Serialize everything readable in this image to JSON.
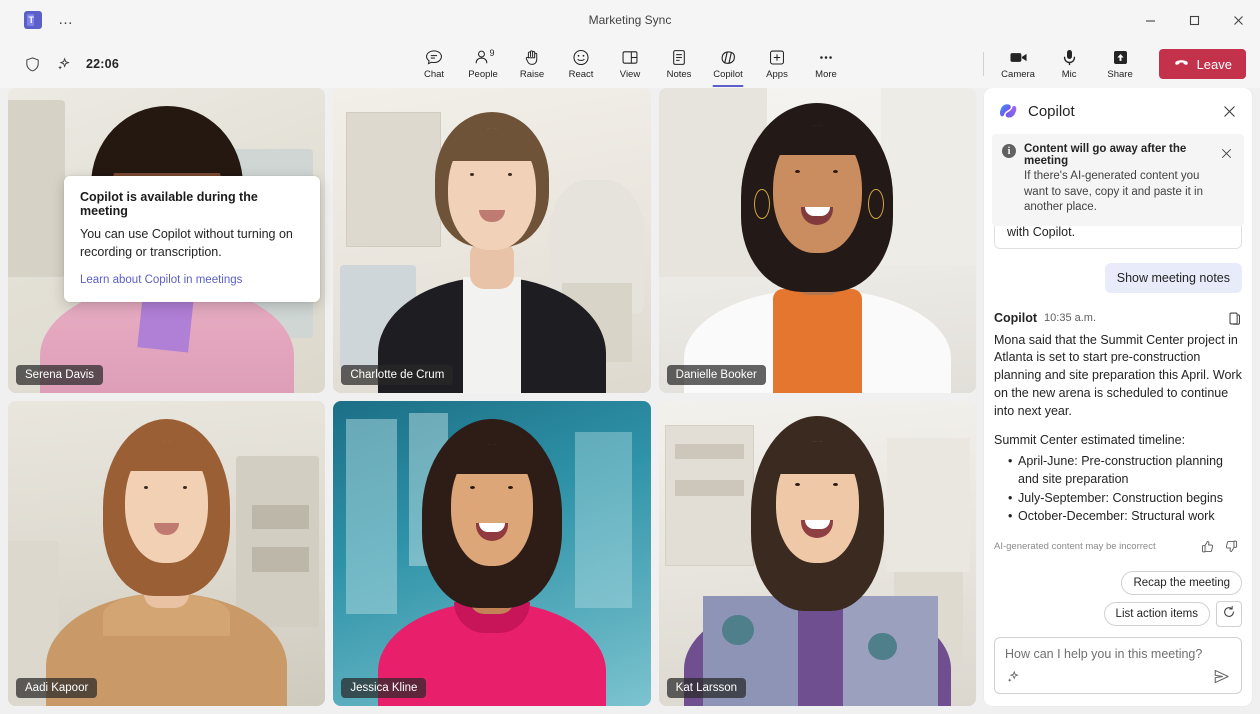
{
  "window": {
    "title": "Marketing Sync",
    "app_menu_label": "…",
    "minimize_label": "Minimize",
    "maximize_label": "Maximize",
    "close_label": "Close"
  },
  "meeting_bar": {
    "shield_icon": "shield-icon",
    "copilot_sparkle_icon": "copilot-sparkle-icon",
    "timer": "22:06",
    "tools": [
      {
        "label": "Chat",
        "icon": "chat-icon",
        "active": false,
        "badge": ""
      },
      {
        "label": "People",
        "icon": "people-icon",
        "active": false,
        "badge": "9"
      },
      {
        "label": "Raise",
        "icon": "raise-hand-icon",
        "active": false,
        "badge": ""
      },
      {
        "label": "React",
        "icon": "react-smiley-icon",
        "active": false,
        "badge": ""
      },
      {
        "label": "View",
        "icon": "view-layout-icon",
        "active": false,
        "badge": ""
      },
      {
        "label": "Notes",
        "icon": "notes-icon",
        "active": false,
        "badge": ""
      },
      {
        "label": "Copilot",
        "icon": "copilot-icon",
        "active": true,
        "badge": ""
      },
      {
        "label": "Apps",
        "icon": "apps-plus-icon",
        "active": false,
        "badge": ""
      },
      {
        "label": "More",
        "icon": "more-ellipsis-icon",
        "active": false,
        "badge": ""
      }
    ],
    "device_controls": [
      {
        "label": "Camera",
        "icon": "camera-icon"
      },
      {
        "label": "Mic",
        "icon": "microphone-icon"
      },
      {
        "label": "Share",
        "icon": "share-screen-icon"
      }
    ],
    "leave_label": "Leave",
    "leave_color": "#c4314b",
    "accent_color": "#5b5fc7"
  },
  "callout": {
    "title": "Copilot is available during the meeting",
    "body": "You can use Copilot without turning on recording or transcription.",
    "link": "Learn about Copilot in meetings"
  },
  "participants": [
    {
      "name": "Serena Davis"
    },
    {
      "name": "Charlotte de Crum"
    },
    {
      "name": "Danielle Booker"
    },
    {
      "name": "Aadi Kapoor"
    },
    {
      "name": "Jessica Kline"
    },
    {
      "name": "Kat Larsson"
    }
  ],
  "copilot_panel": {
    "title": "Copilot",
    "logo_icon": "copilot-logo-icon",
    "close_label": "Close",
    "banner": {
      "icon": "info-icon",
      "title": "Content will go away after the meeting",
      "body": "If there's AI-generated content you want to save, copy it and paste it in another place.",
      "dismiss_label": "Dismiss"
    },
    "clipped_message": "with Copilot.",
    "user_prompt_chip": "Show meeting notes",
    "message": {
      "author": "Copilot",
      "time": "10:35 a.m.",
      "copy_icon": "copy-icon",
      "paragraph": "Mona said that the Summit Center project in Atlanta is set to start pre-construction planning and site preparation this April. Work on the new arena is scheduled to continue into next year.",
      "list_title": "Summit Center estimated timeline:",
      "bullets": [
        "April-June: Pre-construction planning and site preparation",
        "July-September: Construction begins",
        "October-December: Structural work"
      ],
      "disclaimer": "AI-generated content may be incorrect",
      "thumbs_up_icon": "thumbs-up-icon",
      "thumbs_down_icon": "thumbs-down-icon"
    },
    "suggestions": [
      "Recap the meeting",
      "List action items"
    ],
    "refresh_icon": "refresh-icon",
    "compose": {
      "placeholder": "How can I help you in this meeting?",
      "value": "",
      "sparkle_icon": "sparkle-icon",
      "send_icon": "send-icon"
    }
  }
}
